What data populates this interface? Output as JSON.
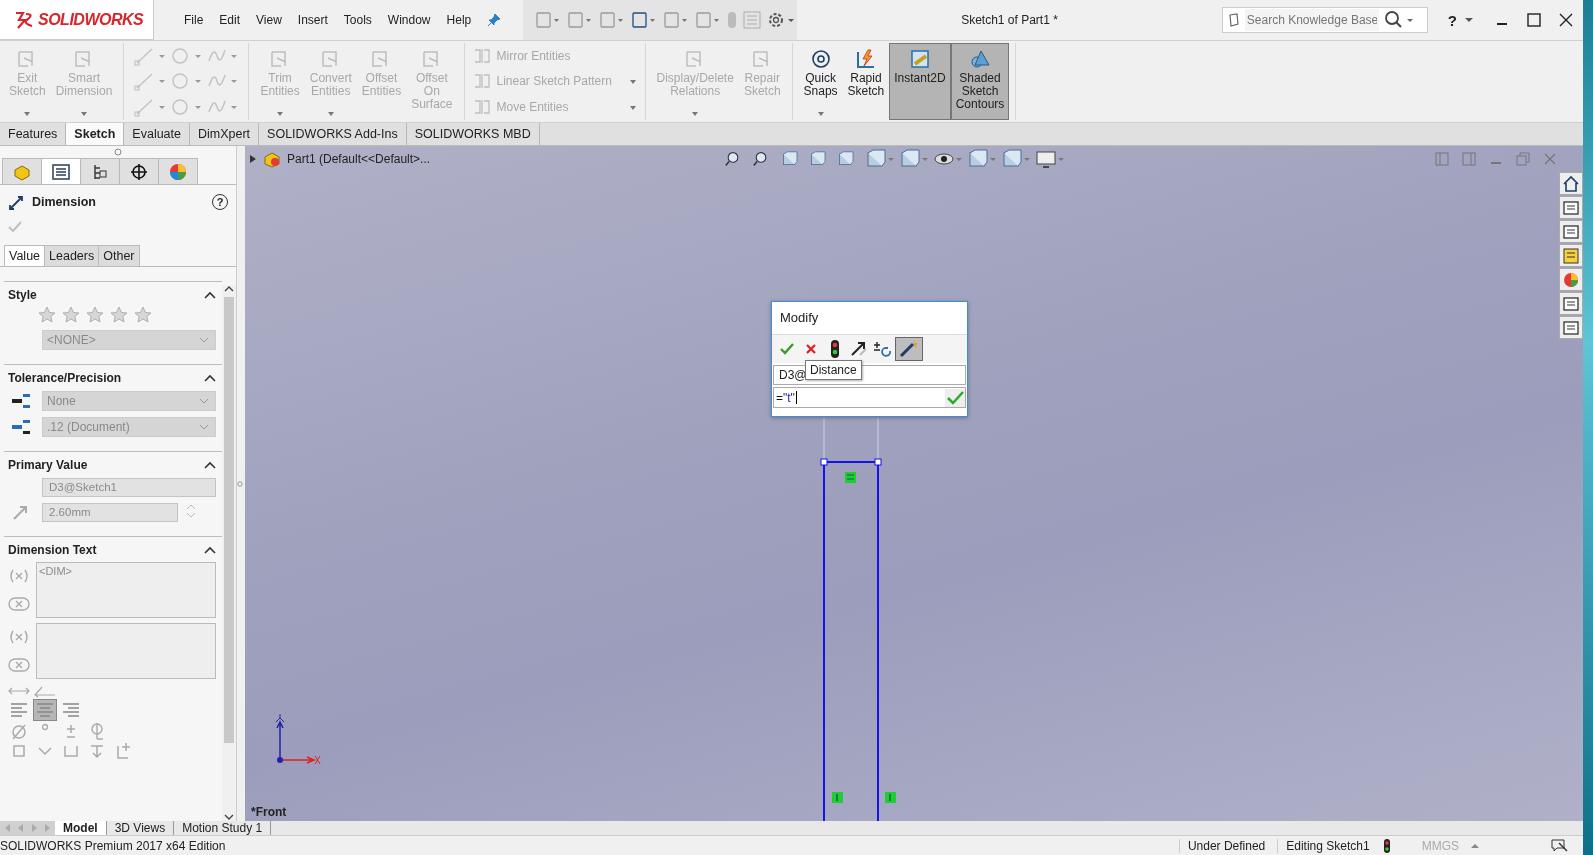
{
  "title_bar": {
    "logo": "SOLIDWORKS",
    "menus": [
      "File",
      "Edit",
      "View",
      "Insert",
      "Tools",
      "Window",
      "Help"
    ],
    "document_title": "Sketch1 of Part1 *",
    "search": {
      "placeholder": "Search Knowledge Base"
    },
    "help": "?"
  },
  "ribbon": {
    "groups": [
      {
        "kind": "large",
        "items": [
          {
            "label": "Exit\nSketch",
            "disabled": true,
            "pressed": false,
            "dropdown": true
          },
          {
            "label": "Smart\nDimension",
            "disabled": true,
            "pressed": false,
            "dropdown": true
          }
        ]
      },
      {
        "kind": "tool-grid"
      },
      {
        "kind": "large",
        "items": [
          {
            "label": "Trim\nEntities",
            "disabled": true,
            "pressed": false,
            "dropdown": true
          },
          {
            "label": "Convert\nEntities",
            "disabled": true,
            "pressed": false,
            "dropdown": true
          },
          {
            "label": "Offset\nEntities",
            "disabled": true,
            "pressed": false,
            "dropdown": false
          },
          {
            "label": "Offset\nOn\nSurface",
            "disabled": true,
            "pressed": false,
            "dropdown": false
          }
        ]
      },
      {
        "kind": "small",
        "items": [
          {
            "label": "Mirror Entities",
            "disabled": true,
            "dropdown": false
          },
          {
            "label": "Linear Sketch Pattern",
            "disabled": true,
            "dropdown": true
          },
          {
            "label": "Move Entities",
            "disabled": true,
            "dropdown": true
          }
        ]
      },
      {
        "kind": "large",
        "items": [
          {
            "label": "Display/Delete\nRelations",
            "disabled": true,
            "pressed": false,
            "dropdown": true
          },
          {
            "label": "Repair\nSketch",
            "disabled": true,
            "pressed": false,
            "dropdown": false
          }
        ]
      },
      {
        "kind": "large",
        "items": [
          {
            "label": "Quick\nSnaps",
            "disabled": false,
            "pressed": false,
            "dropdown": true
          },
          {
            "label": "Rapid\nSketch",
            "disabled": false,
            "pressed": false,
            "dropdown": false
          },
          {
            "label": "Instant2D",
            "disabled": false,
            "pressed": true,
            "dropdown": false
          },
          {
            "label": "Shaded\nSketch\nContours",
            "disabled": false,
            "pressed": true,
            "dropdown": false
          }
        ]
      }
    ]
  },
  "command_tabs": [
    {
      "label": "Features",
      "selected": false
    },
    {
      "label": "Sketch",
      "selected": true
    },
    {
      "label": "Evaluate",
      "selected": false
    },
    {
      "label": "DimXpert",
      "selected": false
    },
    {
      "label": "SOLIDWORKS Add-Ins",
      "selected": false
    },
    {
      "label": "SOLIDWORKS MBD",
      "selected": false
    }
  ],
  "manager_tabs": [
    {
      "kind": "feature-tree",
      "selected": false
    },
    {
      "kind": "property-manager",
      "selected": true
    },
    {
      "kind": "configuration",
      "selected": false
    },
    {
      "kind": "dimxpert",
      "selected": false
    },
    {
      "kind": "display",
      "selected": false
    }
  ],
  "property_manager": {
    "title": "Dimension",
    "help": "?",
    "tabs": [
      {
        "label": "Value",
        "selected": true
      },
      {
        "label": "Leaders",
        "selected": false
      },
      {
        "label": "Other",
        "selected": false
      }
    ],
    "sections": [
      {
        "kind": "style",
        "title": "Style",
        "expanded": true,
        "dropdowns": [
          "<NONE>"
        ]
      },
      {
        "kind": "tolerance",
        "title": "Tolerance/Precision",
        "expanded": true,
        "dropdowns": [
          "None",
          ".12 (Document)"
        ]
      },
      {
        "kind": "primary",
        "title": "Primary Value",
        "expanded": true,
        "name_field": "D3@Sketch1",
        "value_field": "2.60mm"
      },
      {
        "kind": "text",
        "title": "Dimension Text",
        "expanded": true,
        "text_boxes": [
          "<DIM>"
        ]
      }
    ]
  },
  "feature_tree": {
    "label": "Part1  (Default<<Default>...",
    "expanded": false
  },
  "modify_dialog": {
    "title": "Modify",
    "name_field": "D3@",
    "tooltip": "Distance",
    "equals": "=",
    "expression": "\"t\""
  },
  "view_label": "*Front",
  "bottom_tabs": [
    {
      "label": "Model",
      "selected": true
    },
    {
      "label": "3D Views",
      "selected": false
    },
    {
      "label": "Motion Study 1",
      "selected": false
    }
  ],
  "status_bar": {
    "edition": "SOLIDWORKS Premium 2017 x64 Edition",
    "state": "Under Defined",
    "mode": "Editing Sketch1",
    "units": "MMGS"
  }
}
